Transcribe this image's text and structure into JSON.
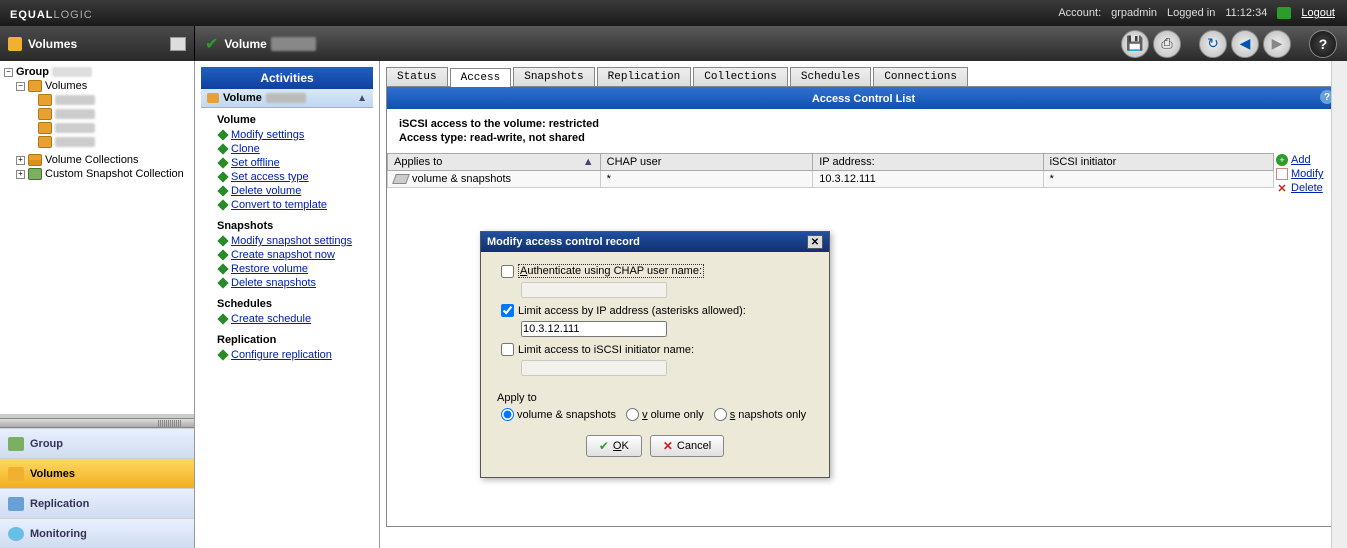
{
  "topbar": {
    "brand_a": "EQUAL",
    "brand_b": "LOGIC",
    "account_label": "Account:",
    "account_value": "grpadmin",
    "status": "Logged in",
    "time": "11:12:34",
    "logout": "Logout"
  },
  "vol_header_left": {
    "title": "Volumes"
  },
  "vol_header_right": {
    "title": "Volume"
  },
  "tree": {
    "group": "Group",
    "volumes": "Volumes",
    "volume_collections": "Volume Collections",
    "custom_snapshot": "Custom Snapshot Collection"
  },
  "navbtns": {
    "group": "Group",
    "volumes": "Volumes",
    "replication": "Replication",
    "monitoring": "Monitoring"
  },
  "activities": {
    "header": "Activities",
    "sub": "Volume",
    "g_volume": "Volume",
    "v_modify": "Modify settings",
    "v_clone": "Clone",
    "v_offline": "Set offline",
    "v_access": "Set access type",
    "v_delete": "Delete volume",
    "v_convert": "Convert to template",
    "g_snapshots": "Snapshots",
    "s_modify": "Modify snapshot settings",
    "s_create": "Create snapshot now",
    "s_restore": "Restore volume",
    "s_delete": "Delete snapshots",
    "g_schedules": "Schedules",
    "sc_create": "Create schedule",
    "g_replication": "Replication",
    "r_configure": "Configure replication"
  },
  "tabs": {
    "status": "Status",
    "access": "Access",
    "snapshots": "Snapshots",
    "replication": "Replication",
    "collections": "Collections",
    "schedules": "Schedules",
    "connections": "Connections"
  },
  "panel": {
    "title": "Access Control List",
    "line1": "iSCSI access to the volume:  restricted",
    "line2": "Access type: read-write, not shared"
  },
  "acl": {
    "cols": {
      "applies": "Applies to",
      "chap": "CHAP user",
      "ip": "IP address:",
      "initiator": "iSCSI initiator"
    },
    "row1": {
      "applies": "volume & snapshots",
      "chap": "*",
      "ip": "10.3.12.111",
      "initiator": "*"
    },
    "actions": {
      "add": "Add",
      "modify": "Modify",
      "delete": "Delete"
    }
  },
  "modal": {
    "title": "Modify access control record",
    "chap_label": "Authenticate using CHAP user name:",
    "ip_label": "Limit access by IP address (asterisks allowed):",
    "ip_value": "10.3.12.111",
    "init_label": "Limit access to iSCSI initiator name:",
    "apply_title": "Apply to",
    "r1": "volume & snapshots",
    "r2": "volume only",
    "r3": "snapshots only",
    "ok": "OK",
    "cancel": "Cancel"
  }
}
